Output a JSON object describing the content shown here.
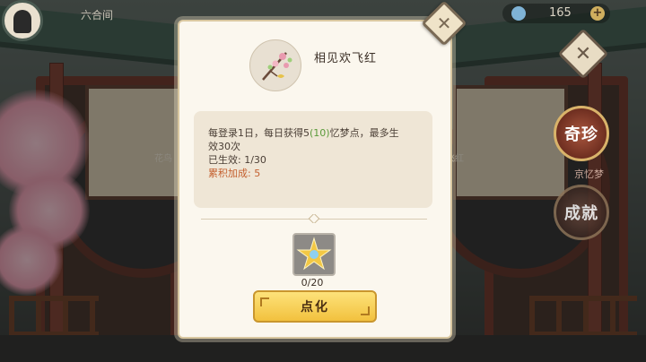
{
  "header": {
    "location": "六合间",
    "currency_value": "165",
    "currency_add": "+"
  },
  "background": {
    "left_frame_label": "花鸟",
    "right_frame_label": "飞红"
  },
  "side": {
    "qizhen_label": "奇珍",
    "ribbon_label": "京忆梦",
    "chengjiu_label": "成就",
    "close_symbol": "✕"
  },
  "dialog": {
    "close_symbol": "✕",
    "title": "相见欢飞红",
    "description": {
      "line1_prefix": "每登录1日，每日获得5",
      "line1_highlight": "(10)",
      "line1_suffix": "忆梦点，最多生",
      "line2": "效30次",
      "line3": "已生效: 1/30",
      "line4": "累积加成: 5"
    },
    "item_count": "0/20",
    "action_label": "点化"
  },
  "colors": {
    "accent_gold": "#f2c13e",
    "highlight_green": "#5a9a3a",
    "accum_orange": "#c4602f"
  }
}
